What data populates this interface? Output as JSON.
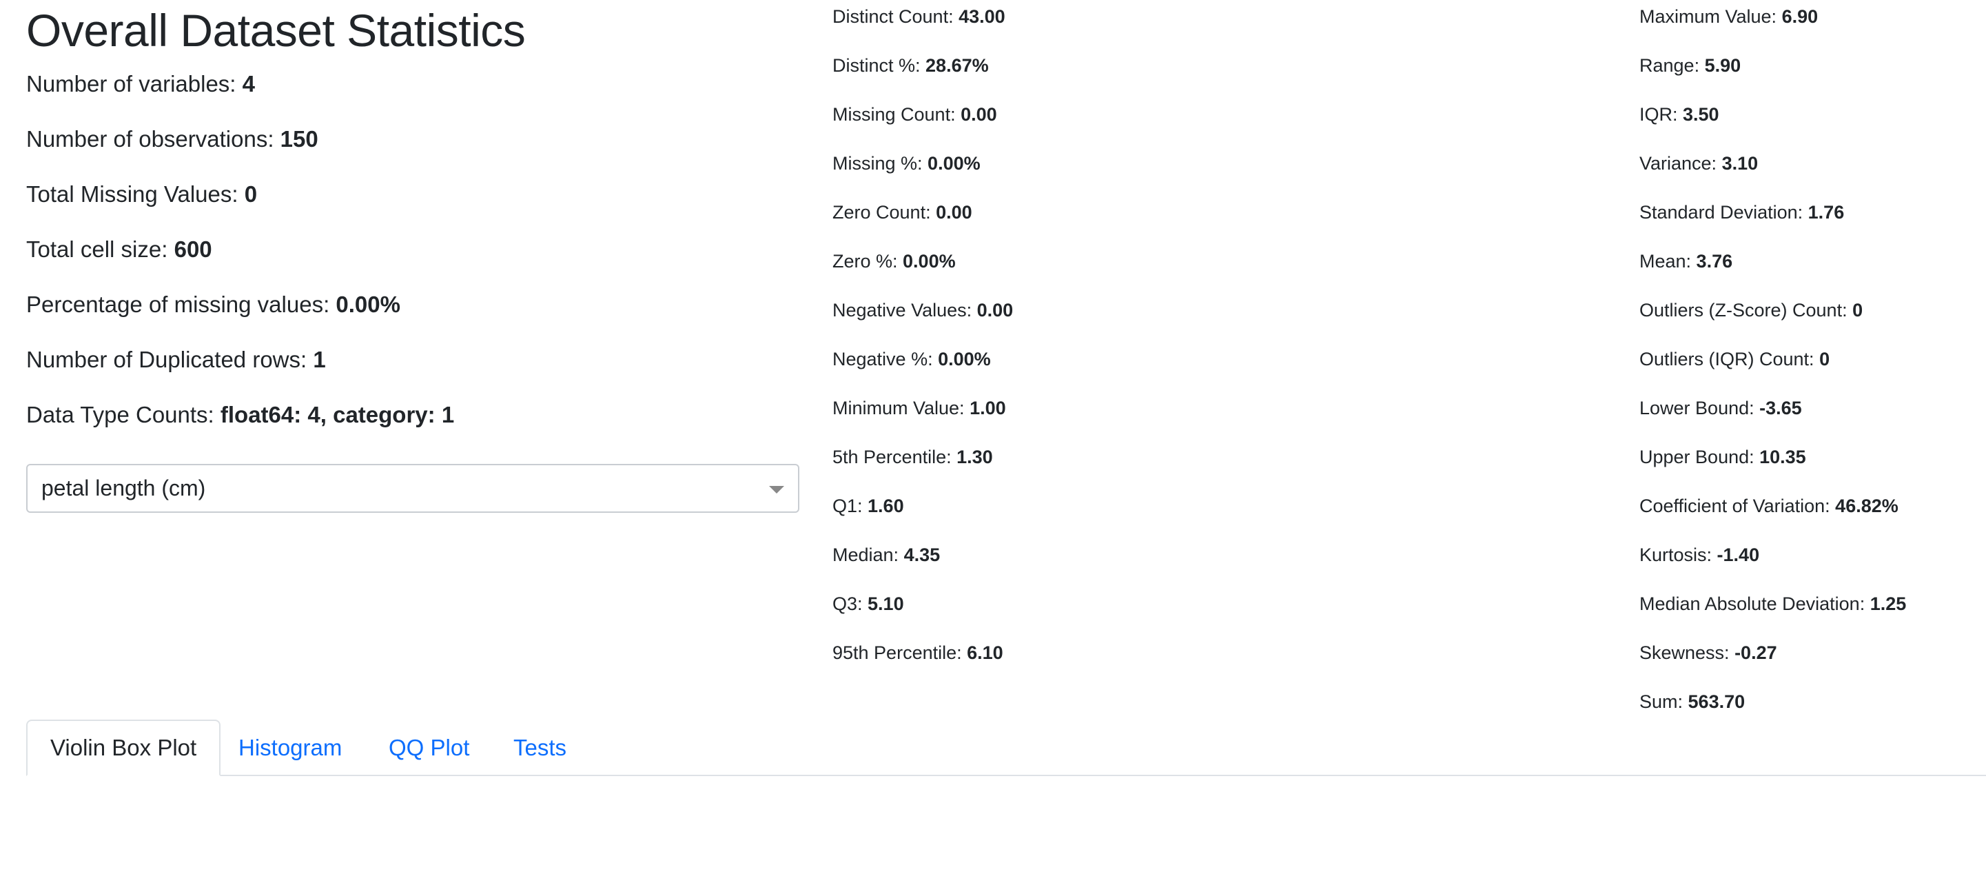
{
  "page_title": "Overall Dataset Statistics",
  "overall": [
    {
      "label": "Number of variables: ",
      "value": "4"
    },
    {
      "label": "Number of observations: ",
      "value": "150"
    },
    {
      "label": "Total Missing Values: ",
      "value": "0"
    },
    {
      "label": "Total cell size: ",
      "value": "600"
    },
    {
      "label": "Percentage of missing values: ",
      "value": "0.00%"
    },
    {
      "label": "Number of Duplicated rows: ",
      "value": "1"
    },
    {
      "label": "Data Type Counts: ",
      "value": "float64: 4, category: 1"
    }
  ],
  "variable_select": {
    "selected": "petal length (cm)"
  },
  "stats_mid": [
    {
      "label": "Distinct Count: ",
      "value": "43.00"
    },
    {
      "label": "Distinct %: ",
      "value": "28.67%"
    },
    {
      "label": "Missing Count: ",
      "value": "0.00"
    },
    {
      "label": "Missing %: ",
      "value": "0.00%"
    },
    {
      "label": "Zero Count: ",
      "value": "0.00"
    },
    {
      "label": "Zero %: ",
      "value": "0.00%"
    },
    {
      "label": "Negative Values: ",
      "value": "0.00"
    },
    {
      "label": "Negative %: ",
      "value": "0.00%"
    },
    {
      "label": "Minimum Value: ",
      "value": "1.00"
    },
    {
      "label": "5th Percentile: ",
      "value": "1.30"
    },
    {
      "label": "Q1: ",
      "value": "1.60"
    },
    {
      "label": "Median: ",
      "value": "4.35"
    },
    {
      "label": "Q3: ",
      "value": "5.10"
    },
    {
      "label": "95th Percentile: ",
      "value": "6.10"
    }
  ],
  "stats_right": [
    {
      "label": "Maximum Value: ",
      "value": "6.90"
    },
    {
      "label": "Range: ",
      "value": "5.90"
    },
    {
      "label": "IQR: ",
      "value": "3.50"
    },
    {
      "label": "Variance: ",
      "value": "3.10"
    },
    {
      "label": "Standard Deviation: ",
      "value": "1.76"
    },
    {
      "label": "Mean: ",
      "value": "3.76"
    },
    {
      "label": "Outliers (Z-Score) Count: ",
      "value": "0"
    },
    {
      "label": "Outliers (IQR) Count: ",
      "value": "0"
    },
    {
      "label": "Lower Bound: ",
      "value": "-3.65"
    },
    {
      "label": "Upper Bound: ",
      "value": "10.35"
    },
    {
      "label": "Coefficient of Variation: ",
      "value": "46.82%"
    },
    {
      "label": "Kurtosis: ",
      "value": "-1.40"
    },
    {
      "label": "Median Absolute Deviation: ",
      "value": "1.25"
    },
    {
      "label": "Skewness: ",
      "value": "-0.27"
    },
    {
      "label": "Sum: ",
      "value": "563.70"
    }
  ],
  "tabs": [
    {
      "label": "Violin Box Plot",
      "active": true
    },
    {
      "label": "Histogram",
      "active": false
    },
    {
      "label": "QQ Plot",
      "active": false
    },
    {
      "label": "Tests",
      "active": false
    }
  ],
  "colors": {
    "link": "#0d6efd",
    "text": "#212529",
    "border": "#dee2e6"
  }
}
